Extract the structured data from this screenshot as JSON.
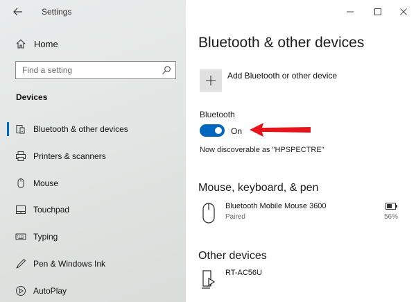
{
  "window": {
    "title": "Settings"
  },
  "sidebar": {
    "home_label": "Home",
    "search": {
      "placeholder": "Find a setting",
      "value": ""
    },
    "section_heading": "Devices",
    "items": [
      {
        "label": "Bluetooth & other devices",
        "icon": "bluetooth-devices-icon",
        "active": true
      },
      {
        "label": "Printers & scanners",
        "icon": "printer-icon"
      },
      {
        "label": "Mouse",
        "icon": "mouse-icon"
      },
      {
        "label": "Touchpad",
        "icon": "touchpad-icon"
      },
      {
        "label": "Typing",
        "icon": "keyboard-icon"
      },
      {
        "label": "Pen & Windows Ink",
        "icon": "pen-icon"
      },
      {
        "label": "AutoPlay",
        "icon": "autoplay-icon"
      }
    ]
  },
  "main": {
    "title": "Bluetooth & other devices",
    "add_device_label": "Add Bluetooth or other device",
    "bluetooth": {
      "label": "Bluetooth",
      "state_label": "On",
      "discoverable_text": "Now discoverable as \"HPSPECTRE\""
    },
    "mouse_section": {
      "heading": "Mouse, keyboard, & pen",
      "devices": [
        {
          "name": "Bluetooth Mobile Mouse 3600",
          "status": "Paired",
          "battery": "56%"
        }
      ]
    },
    "other_section": {
      "heading": "Other devices",
      "devices": [
        {
          "name": "RT-AC56U"
        }
      ]
    }
  },
  "colors": {
    "accent": "#0067c0",
    "annotation_arrow": "#e8141b",
    "sidebar_bg": "#e4e7e6"
  }
}
